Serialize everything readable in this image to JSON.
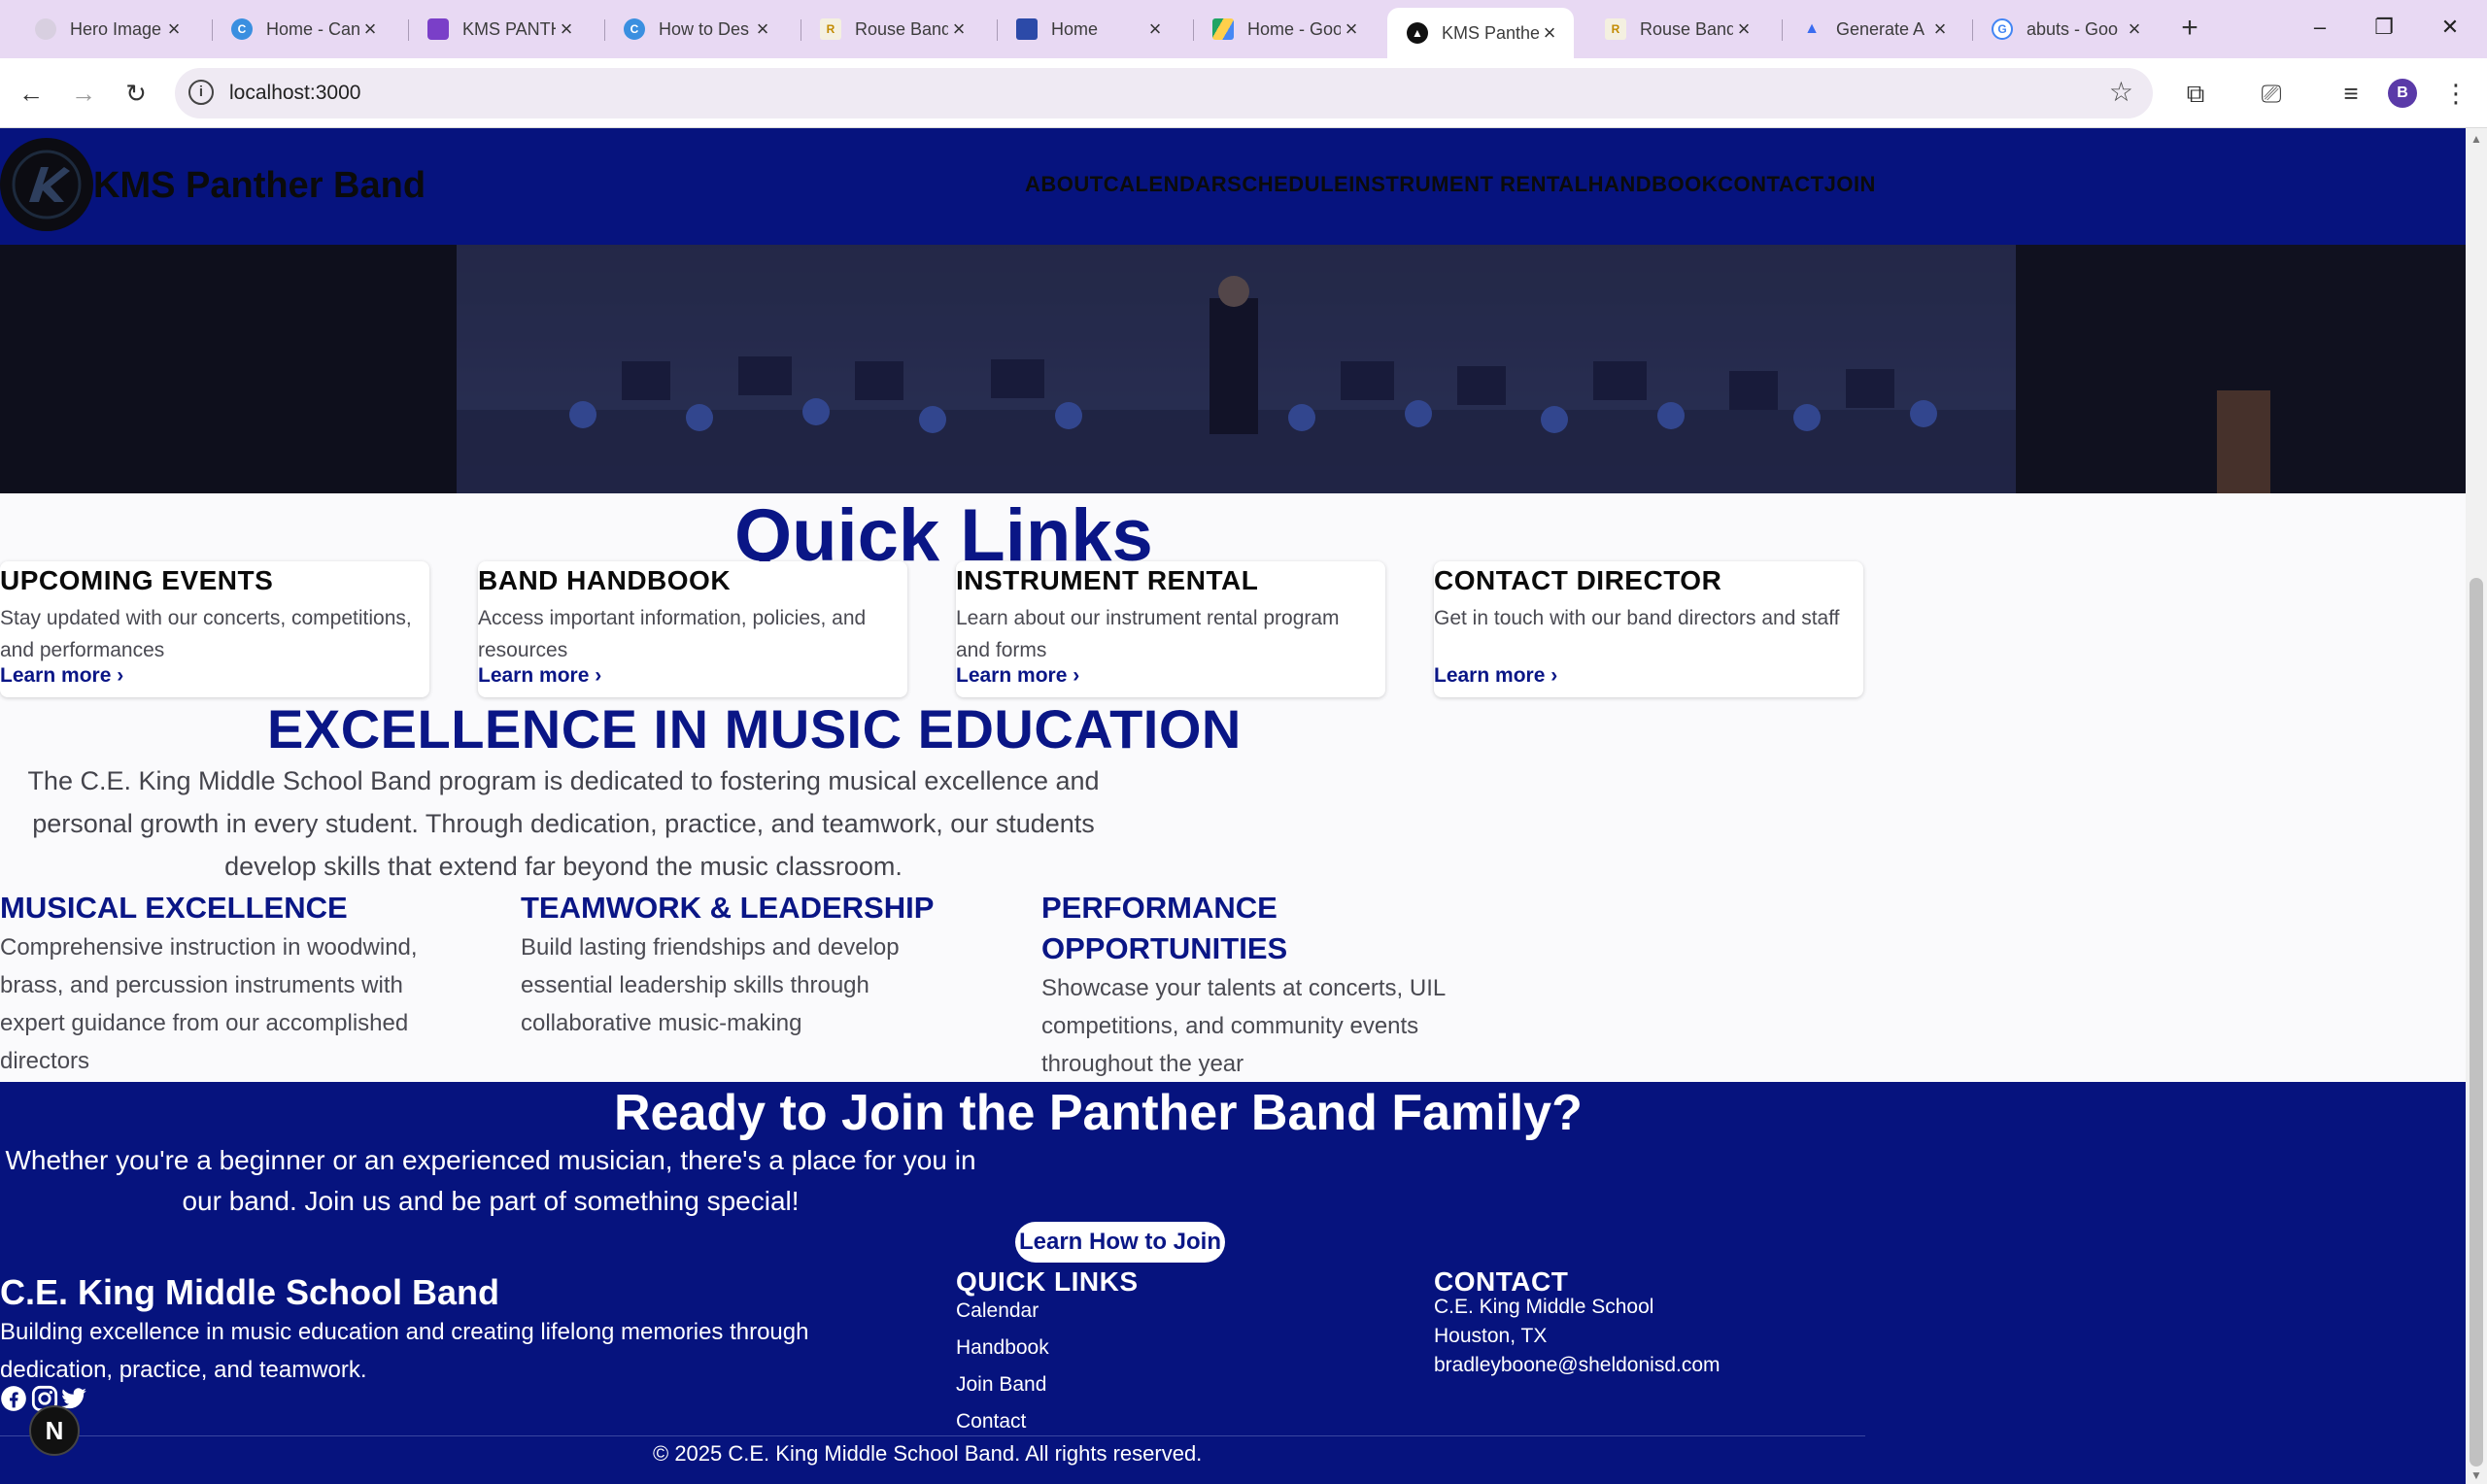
{
  "browser": {
    "tabs": [
      {
        "title": "Hero Image",
        "favicon": "faded-circle-icon"
      },
      {
        "title": "Home - Can",
        "favicon": "canva-icon"
      },
      {
        "title": "KMS PANTH",
        "favicon": "purple-page-icon"
      },
      {
        "title": "How to Des",
        "favicon": "canva-icon"
      },
      {
        "title": "Rouse Band",
        "favicon": "band-page-icon"
      },
      {
        "title": "Home",
        "favicon": "blue-grid-icon"
      },
      {
        "title": "Home - Goo",
        "favicon": "google-drive-icon"
      },
      {
        "title": "KMS Panthe",
        "favicon": "triangle-logo-icon"
      },
      {
        "title": "Rouse Band",
        "favicon": "band-page-icon"
      },
      {
        "title": "Generate A",
        "favicon": "triangle-blue-icon"
      },
      {
        "title": "abuts - Goo",
        "favicon": "google-g-icon"
      }
    ],
    "active_tab_index": 7,
    "new_tab_label": "+",
    "url": "localhost:3000",
    "profile_initial": "B"
  },
  "site": {
    "brand": "KMS Panther Band",
    "nav": [
      "ABOUT",
      "CALENDAR",
      "SCHEDULE",
      "INSTRUMENT RENTAL",
      "HANDBOOK",
      "CONTACT",
      "JOIN"
    ]
  },
  "quick_links": {
    "title": "Quick Links",
    "cards": [
      {
        "title": "UPCOMING EVENTS",
        "desc": "Stay updated with our concerts, competitions, and performances",
        "link": "Learn more ›"
      },
      {
        "title": "BAND HANDBOOK",
        "desc": "Access important information, policies, and resources",
        "link": "Learn more ›"
      },
      {
        "title": "INSTRUMENT RENTAL",
        "desc": "Learn about our instrument rental program and forms",
        "link": "Learn more ›"
      },
      {
        "title": "CONTACT DIRECTOR",
        "desc": "Get in touch with our band directors and staff",
        "link": "Learn more ›"
      }
    ]
  },
  "excellence": {
    "title": "EXCELLENCE IN MUSIC EDUCATION",
    "body": "The C.E. King Middle School Band program is dedicated to fostering musical excellence and personal growth in every student. Through dedication, practice, and teamwork, our students develop skills that extend far beyond the music classroom.",
    "features": [
      {
        "title": "MUSICAL EXCELLENCE",
        "desc": "Comprehensive instruction in woodwind, brass, and percussion instruments with expert guidance from our accomplished directors"
      },
      {
        "title": "TEAMWORK & LEADERSHIP",
        "desc": "Build lasting friendships and develop essential leadership skills through collaborative music-making"
      },
      {
        "title": "PERFORMANCE OPPORTUNITIES",
        "desc": "Showcase your talents at concerts, UIL competitions, and community events throughout the year"
      }
    ]
  },
  "cta": {
    "title": "Ready to Join the Panther Band Family?",
    "body": "Whether you're a beginner or an experienced musician, there's a place for you in our band. Join us and be part of something special!",
    "button": "Learn How to Join"
  },
  "footer": {
    "name": "C.E. King Middle School Band",
    "desc": "Building excellence in music education and creating lifelong memories through dedication, practice, and teamwork.",
    "quick_links_heading": "QUICK LINKS",
    "quick_links": [
      "Calendar",
      "Handbook",
      "Join Band",
      "Contact"
    ],
    "contact_heading": "CONTACT",
    "contact_lines": [
      "C.E. King Middle School",
      "Houston, TX",
      "bradleyboone@sheldonisd.com"
    ],
    "copyright": "© 2025 C.E. King Middle School Band. All rights reserved.",
    "social": [
      "facebook-icon",
      "instagram-icon",
      "twitter-icon"
    ]
  },
  "dev_badge": "N",
  "colors": {
    "navy": "#06137e",
    "accent_text": "#0a1686",
    "tab_strip": "#e8d9f3"
  }
}
